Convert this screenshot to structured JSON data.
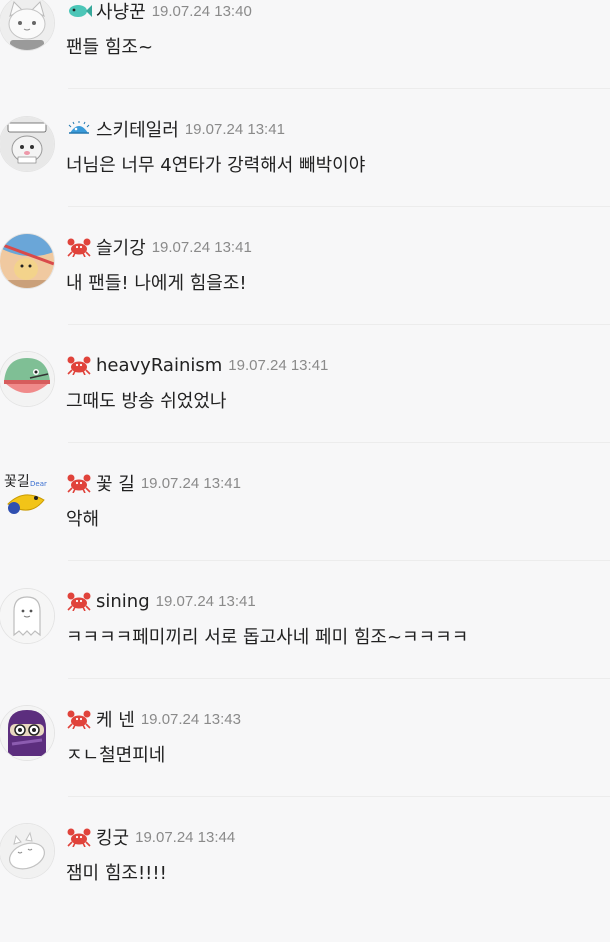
{
  "comments": [
    {
      "badge_icon": "fish-icon",
      "avatar_icon": "cat-avatar-icon",
      "nickname": "사냥꾼",
      "timestamp": "19.07.24 13:40",
      "message": "팬들 힘조~"
    },
    {
      "badge_icon": "blowfish-icon",
      "avatar_icon": "hamster-sticker-avatar-icon",
      "nickname": "스키테일러",
      "timestamp": "19.07.24 13:41",
      "message": "너님은 너무 4연타가 강력해서 빼박이야"
    },
    {
      "badge_icon": "crab-icon",
      "avatar_icon": "hamster-photo-avatar-icon",
      "nickname": "슬기강",
      "timestamp": "19.07.24 13:41",
      "message": "내 팬들! 나에게 힘을조!"
    },
    {
      "badge_icon": "crab-icon",
      "avatar_icon": "green-bird-avatar-icon",
      "nickname": "heavyRainism",
      "timestamp": "19.07.24 13:41",
      "message": "그때도 방송 쉬었었나"
    },
    {
      "badge_icon": "crab-icon",
      "avatar_icon": "yellow-fish-avatar-icon",
      "nickname": "꽃 길",
      "timestamp": "19.07.24 13:41",
      "message": "악해"
    },
    {
      "badge_icon": "crab-icon",
      "avatar_icon": "ghost-avatar-icon",
      "nickname": "sining",
      "timestamp": "19.07.24 13:41",
      "message": "ㅋㅋㅋㅋ페미끼리 서로 돕고사네 페미 힘조~ㅋㅋㅋㅋ"
    },
    {
      "badge_icon": "crab-icon",
      "avatar_icon": "purple-ninja-avatar-icon",
      "nickname": "케 넨",
      "timestamp": "19.07.24 13:43",
      "message": "ㅈㄴ철면피네"
    },
    {
      "badge_icon": "crab-icon",
      "avatar_icon": "sleeping-cat-avatar-icon",
      "nickname": "킹굿",
      "timestamp": "19.07.24 13:44",
      "message": "잼미 힘조!!!!"
    }
  ]
}
